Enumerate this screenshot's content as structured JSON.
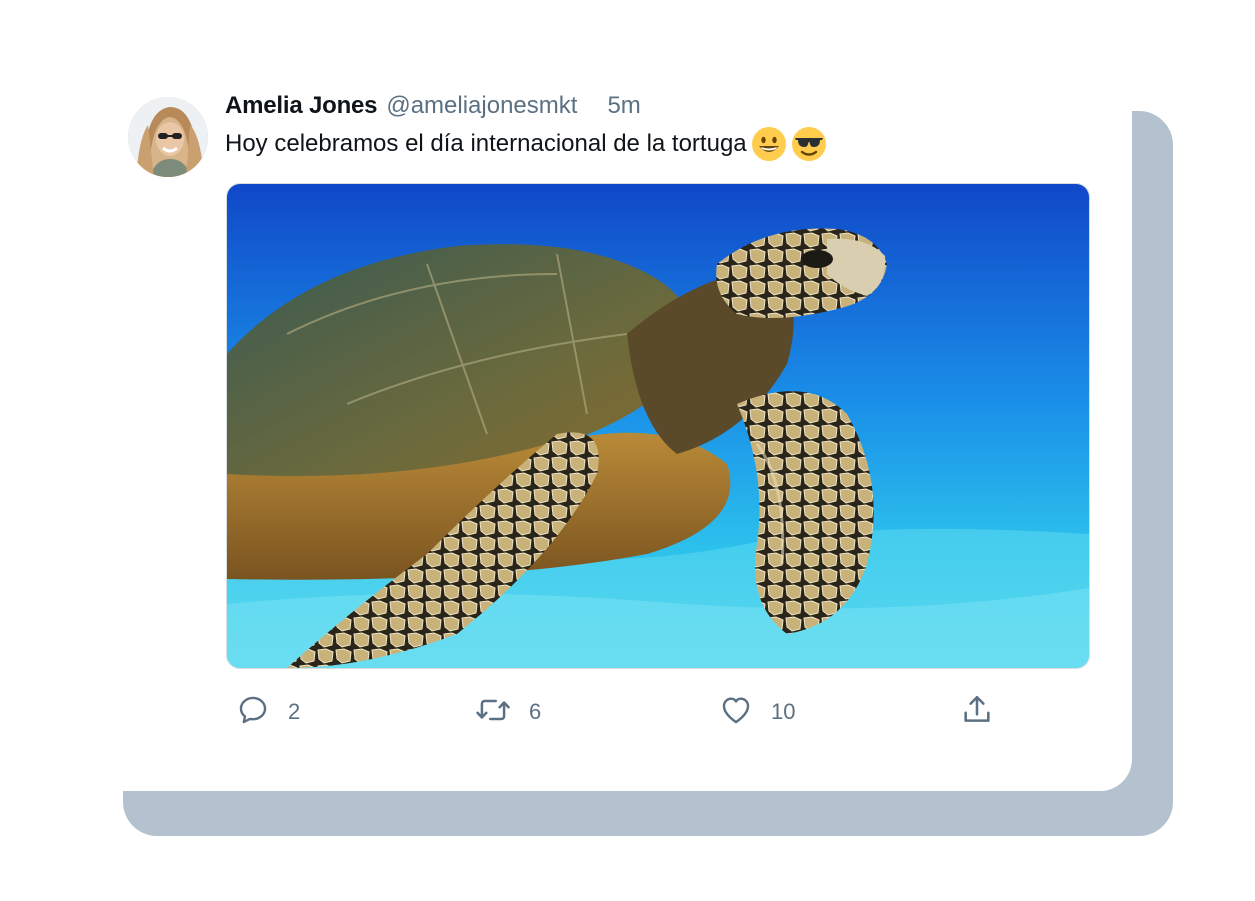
{
  "tweet": {
    "author_name": "Amelia Jones",
    "handle": "@ameliajonesmkt",
    "time": "5m",
    "text": "Hoy celebramos el día internacional de la tortuga",
    "emojis": [
      "grinning-face",
      "smiling-face-with-sunglasses"
    ],
    "media": {
      "description_icon": "sea-turtle-photo"
    },
    "actions": {
      "reply_count": "2",
      "retweet_count": "6",
      "like_count": "10"
    }
  },
  "colors": {
    "shadow": "#b4c2cf",
    "secondary_text": "#5b7083",
    "primary_text": "#0f1419"
  }
}
